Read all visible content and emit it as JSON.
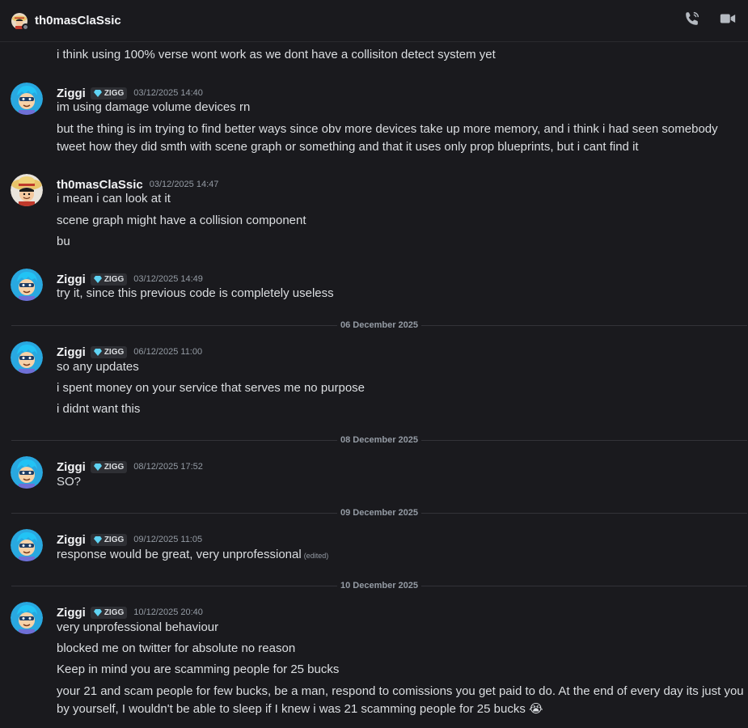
{
  "header": {
    "title": "th0masClaSsic",
    "call_icon": "phone-call-icon",
    "video_icon": "video-camera-icon"
  },
  "users": {
    "ziggi": {
      "name": "Ziggi",
      "tag": "ZIGG",
      "tag_icon": "diamond-icon"
    },
    "thomas": {
      "name": "th0masClaSsic"
    }
  },
  "messages": {
    "partial_1": "i think using 100% verse wont work as we dont have a collisiton detect system yet",
    "g1": {
      "ts": "03/12/2025 14:40",
      "lines": [
        "im using damage volume devices rn",
        "but the thing is im trying to find better ways since obv more devices take up more memory, and i think i had seen somebody tweet how they did smth with scene graph or something and that it uses only prop blueprints, but i cant find it"
      ]
    },
    "g2": {
      "ts": "03/12/2025 14:47",
      "lines": [
        "i mean i can look at it",
        "scene graph might have a collision component",
        "bu"
      ]
    },
    "g3": {
      "ts": "03/12/2025 14:49",
      "lines": [
        "try it, since this previous code is completely useless"
      ]
    },
    "div1": "06 December 2025",
    "g4": {
      "ts": "06/12/2025 11:00",
      "lines": [
        "so any updates",
        "i spent money on your service that serves me no purpose",
        "i didnt want this"
      ]
    },
    "div2": "08 December 2025",
    "g5": {
      "ts": "08/12/2025 17:52",
      "lines": [
        "SO?"
      ]
    },
    "div3": "09 December 2025",
    "g6": {
      "ts": "09/12/2025 11:05",
      "lines": [
        "response would be great, very unprofessional"
      ],
      "edited": "(edited)"
    },
    "div4": "10 December 2025",
    "g7": {
      "ts": "10/12/2025 20:40",
      "lines": [
        "very unprofessional behaviour",
        "blocked me on twitter for absolute no reason",
        "Keep in mind you are scamming people for 25 bucks",
        "your 21 and scam people for few bucks, be a man, respond to comissions you get paid to do. At the end of every day its just you by yourself, I wouldn't be able to sleep if I knew i was 21 scamming people for 25 bucks",
        "😭"
      ]
    }
  }
}
